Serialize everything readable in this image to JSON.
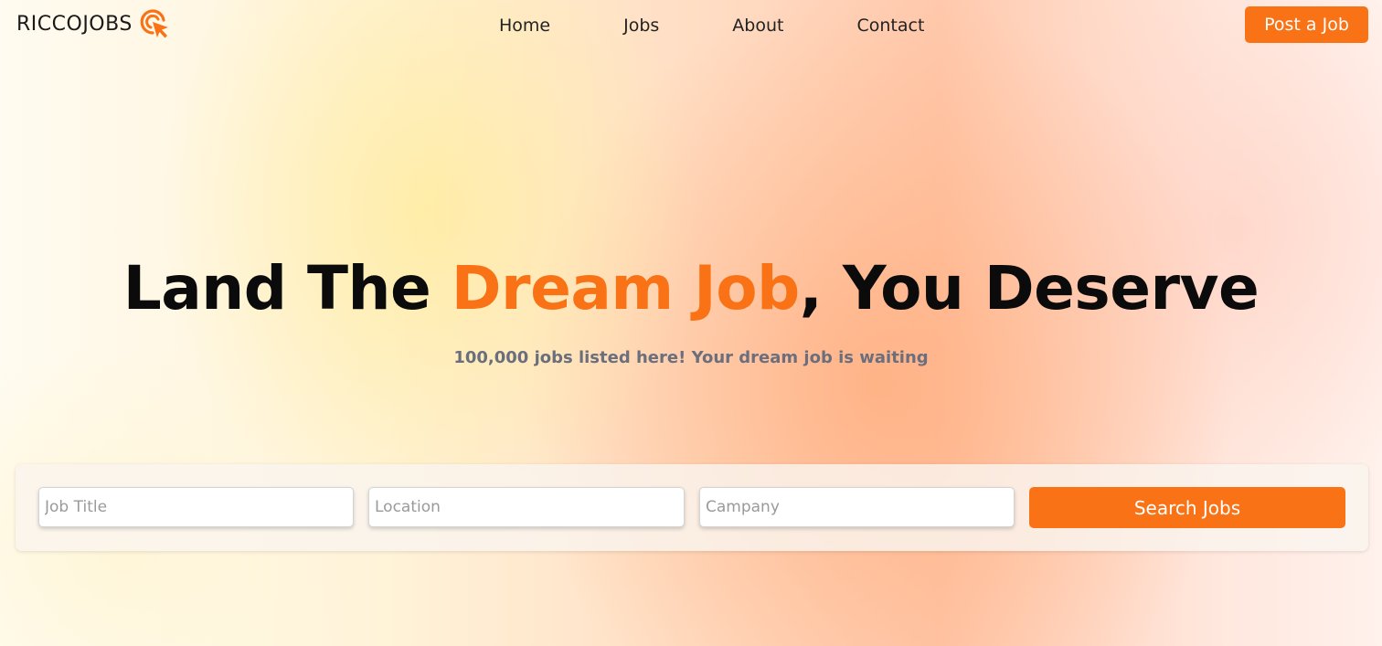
{
  "brand": {
    "name": "RICCOJOBS",
    "logo_icon": "cursor-click-target-icon",
    "accent_color": "#f97316"
  },
  "nav": {
    "links": [
      "Home",
      "Jobs",
      "About",
      "Contact"
    ],
    "cta_label": "Post a Job"
  },
  "hero": {
    "title_before": "Land The ",
    "title_accent": "Dream Job",
    "title_after": ", You Deserve",
    "subtitle": "100,000 jobs listed here! Your dream job is waiting"
  },
  "search": {
    "job_title_placeholder": "Job Title",
    "location_placeholder": "Location",
    "company_placeholder": "Campany",
    "button_label": "Search Jobs"
  }
}
